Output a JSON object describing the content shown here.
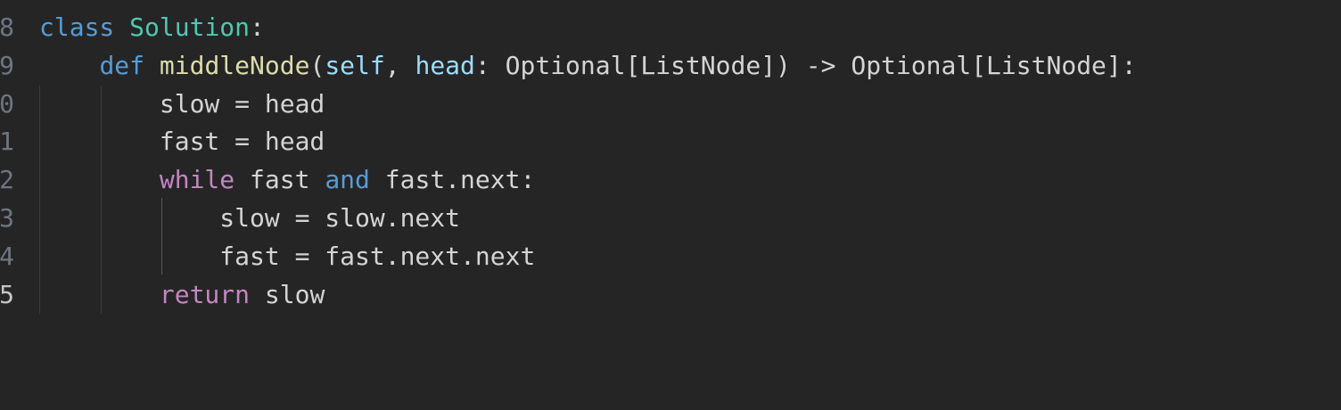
{
  "editor": {
    "line_numbers": [
      "8",
      "9",
      "0",
      "1",
      "2",
      "3",
      "4",
      "5"
    ],
    "lines": [
      {
        "tokens": [
          {
            "text": "class",
            "cls": "kw-blue"
          },
          {
            "text": " ",
            "cls": "plain"
          },
          {
            "text": "Solution",
            "cls": "cls"
          },
          {
            "text": ":",
            "cls": "plain"
          }
        ]
      },
      {
        "tokens": [
          {
            "text": "    ",
            "cls": "plain"
          },
          {
            "text": "def",
            "cls": "kw-blue"
          },
          {
            "text": " ",
            "cls": "plain"
          },
          {
            "text": "middleNode",
            "cls": "fn"
          },
          {
            "text": "(",
            "cls": "plain"
          },
          {
            "text": "self",
            "cls": "param"
          },
          {
            "text": ", ",
            "cls": "plain"
          },
          {
            "text": "head",
            "cls": "param"
          },
          {
            "text": ": Optional[ListNode]) -> Optional[ListNode]:",
            "cls": "plain"
          }
        ]
      },
      {
        "tokens": [
          {
            "text": "        slow = head",
            "cls": "plain"
          }
        ]
      },
      {
        "tokens": [
          {
            "text": "        fast = head",
            "cls": "plain"
          }
        ]
      },
      {
        "tokens": [
          {
            "text": "        ",
            "cls": "plain"
          },
          {
            "text": "while",
            "cls": "kw-purple"
          },
          {
            "text": " fast ",
            "cls": "plain"
          },
          {
            "text": "and",
            "cls": "kw-blue"
          },
          {
            "text": " fast.next:",
            "cls": "plain"
          }
        ]
      },
      {
        "tokens": [
          {
            "text": "            slow = slow.next",
            "cls": "plain"
          }
        ]
      },
      {
        "tokens": [
          {
            "text": "            fast = fast.next.next",
            "cls": "plain"
          }
        ]
      },
      {
        "tokens": [
          {
            "text": "        ",
            "cls": "plain"
          },
          {
            "text": "return",
            "cls": "kw-purple"
          },
          {
            "text": " slow",
            "cls": "plain"
          }
        ]
      }
    ],
    "active_line_index": 7
  },
  "colors": {
    "background": "#252526",
    "keyword": "#569cd6",
    "control_keyword": "#c586c0",
    "class_name": "#4ec9b0",
    "function_name": "#dcdcaa",
    "parameter": "#9cdcfe",
    "text": "#d4d4d4"
  }
}
